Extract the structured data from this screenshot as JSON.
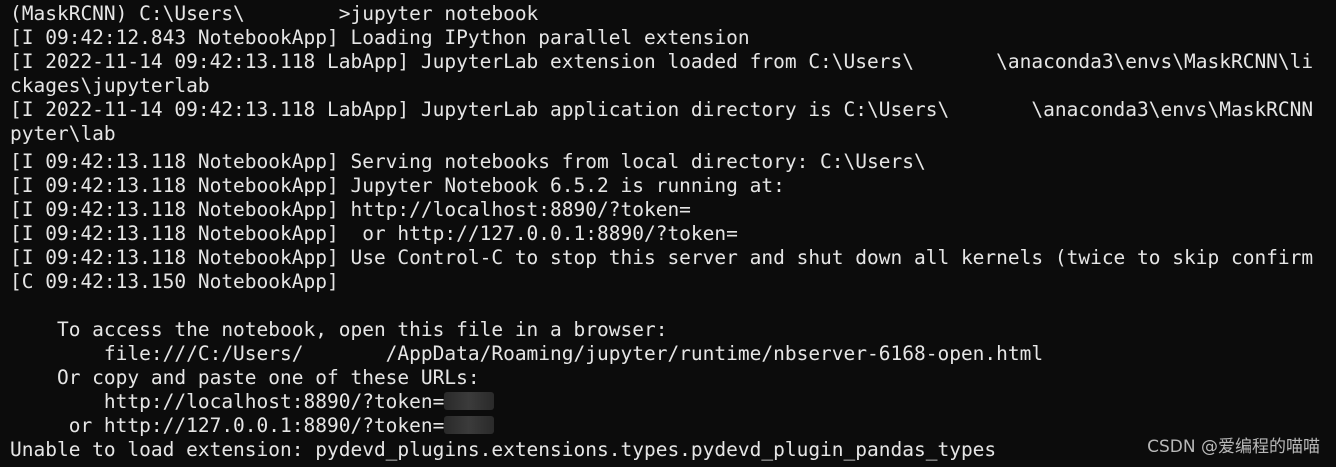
{
  "terminal": {
    "lines": [
      "(MaskRCNN) C:\\Users\\        >jupyter notebook",
      "[I 09:42:12.843 NotebookApp] Loading IPython parallel extension",
      "[I 2022-11-14 09:42:13.118 LabApp] JupyterLab extension loaded from C:\\Users\\       \\anaconda3\\envs\\MaskRCNN\\li",
      "ckages\\jupyterlab",
      "[I 2022-11-14 09:42:13.118 LabApp] JupyterLab application directory is C:\\Users\\       \\anaconda3\\envs\\MaskRCNN",
      "pyter\\lab",
      "[I 09:42:13.118 NotebookApp] Serving notebooks from local directory: C:\\Users\\",
      "[I 09:42:13.118 NotebookApp] Jupyter Notebook 6.5.2 is running at:",
      "[I 09:42:13.118 NotebookApp] http://localhost:8890/?token=",
      "[I 09:42:13.118 NotebookApp]  or http://127.0.0.1:8890/?token=",
      "[I 09:42:13.118 NotebookApp] Use Control-C to stop this server and shut down all kernels (twice to skip confirm",
      "[C 09:42:13.150 NotebookApp]",
      "",
      "    To access the notebook, open this file in a browser:",
      "        file:///C:/Users/       /AppData/Roaming/jupyter/runtime/nbserver-6168-open.html",
      "    Or copy and paste one of these URLs:",
      "        http://localhost:8890/?token=",
      "     or http://127.0.0.1:8890/?token=",
      "Unable to load extension: pydevd_plugins.extensions.types.pydevd_plugin_pandas_types"
    ]
  },
  "watermark": "CSDN @爱编程的喵喵",
  "colors": {
    "background": "#0c0c0c",
    "text": "#e6e6e6"
  }
}
